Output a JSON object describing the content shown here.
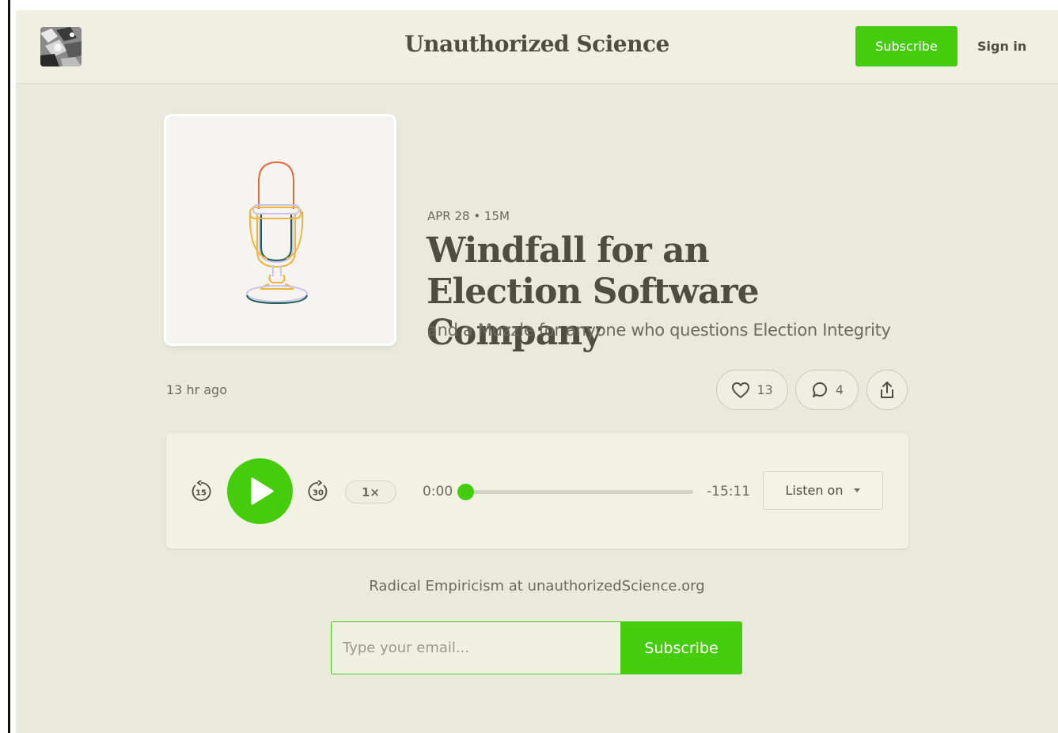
{
  "header": {
    "site_title": "Unauthorized Science",
    "subscribe_label": "Subscribe",
    "sign_in_label": "Sign in",
    "logo_icon": "publication-logo"
  },
  "post": {
    "meta": "APR 28 • 15M",
    "title": "Windfall for an Election Software Company",
    "subtitle": "and a Muzzle for anyone who questions Election Integrity",
    "time_ago": "13 hr ago",
    "cover_icon": "microphone-icon"
  },
  "actions": {
    "like_count": "13",
    "comment_count": "4",
    "like_icon": "heart-icon",
    "comment_icon": "comment-bubble-icon",
    "share_icon": "share-icon"
  },
  "player": {
    "skip_back_label": "15",
    "skip_forward_label": "30",
    "speed_label": "1×",
    "current_time": "0:00",
    "remaining_time": "-15:11",
    "progress_fraction": 0,
    "listen_on_label": "Listen on"
  },
  "signup": {
    "tagline": "Radical Empiricism at unauthorizedScience.org",
    "email_placeholder": "Type your email...",
    "subscribe_label": "Subscribe"
  },
  "colors": {
    "accent": "#45cc0c",
    "background": "#e9e9dc",
    "text": "#4d4d42"
  }
}
